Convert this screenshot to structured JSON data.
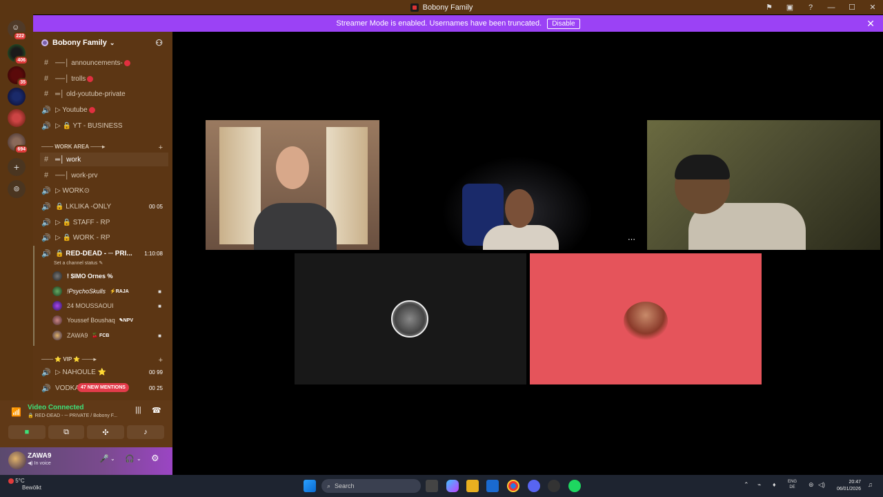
{
  "window": {
    "title": "Bobony Family"
  },
  "banner": {
    "text": "Streamer Mode is enabled. Usernames have been truncated.",
    "disable_label": "Disable"
  },
  "rail": {
    "badges": [
      "222",
      "406",
      "35",
      "694"
    ]
  },
  "server": {
    "name": "Bobony Family"
  },
  "channels": [
    {
      "label": "──│ announcements-",
      "type": "text",
      "red": true
    },
    {
      "label": "──│ trolls",
      "type": "text",
      "red": true
    },
    {
      "label": "═│ old-youtube-private",
      "type": "text",
      "red": false
    },
    {
      "label": "▷ Youtube",
      "type": "voice",
      "red": true
    },
    {
      "label": "▷ 🔒 YT - BUSINESS",
      "type": "voice",
      "red": false
    }
  ],
  "category_work": "─── WORK AREA ───▸",
  "work_channels": [
    {
      "label": "═│ work",
      "type": "text"
    },
    {
      "label": "──│ work-prv",
      "type": "text"
    },
    {
      "label": "▷ WORK⊙",
      "type": "voice"
    },
    {
      "label": "🔒 LKLIKA -ONLY",
      "type": "voice",
      "right": "00  05"
    },
    {
      "label": "▷ 🔒 STAFF - RP",
      "type": "voice"
    },
    {
      "label": "▷ 🔒 WORK - RP",
      "type": "voice"
    }
  ],
  "active_voice": {
    "label": "🔒 RED-DEAD - ─ PRI...",
    "timer": "1:10:08",
    "status_hint": "Set a channel status ✎"
  },
  "voice_users": [
    {
      "name": "! $IMO Ornes %",
      "tag": "",
      "cam": false
    },
    {
      "name": "!PsychoSkulls",
      "tag": "⚡RAJA",
      "cam": true
    },
    {
      "name": "24 MOUSSAOUI",
      "tag": "",
      "cam": true
    },
    {
      "name": "Youssef Boushaq",
      "tag": "✎NPV",
      "cam": false
    },
    {
      "name": "ZAWA9",
      "tag": "🍒 FCB",
      "cam": true
    }
  ],
  "category_vip": "─── ⭐ VIP ⭐ ───▸",
  "vip_channels": [
    {
      "label": "▷ NAHOULE ⭐",
      "right": "00  99"
    },
    {
      "label": "VODKA",
      "right": "00  25"
    }
  ],
  "mentions": "47 NEW MENTIONS",
  "voice_panel": {
    "status": "Video Connected",
    "channel": "🔒 RED-DEAD - ─ PRIVATE / Bobony F..."
  },
  "user": {
    "name": "ZAWA9",
    "status": "◀) In voice"
  },
  "taskbar": {
    "temp": "5°C",
    "weather": "Bewölkt",
    "search": "Search",
    "lang_top": "ENG",
    "lang_bottom": "DE",
    "time": "20:47",
    "date": "06/01/2026"
  },
  "colors": {
    "sidebar": "#5c3614",
    "banner": "#9b42f5",
    "voice_green": "#3ee07a",
    "mention_red": "#e33b4a",
    "tile_red": "#e5545b"
  }
}
